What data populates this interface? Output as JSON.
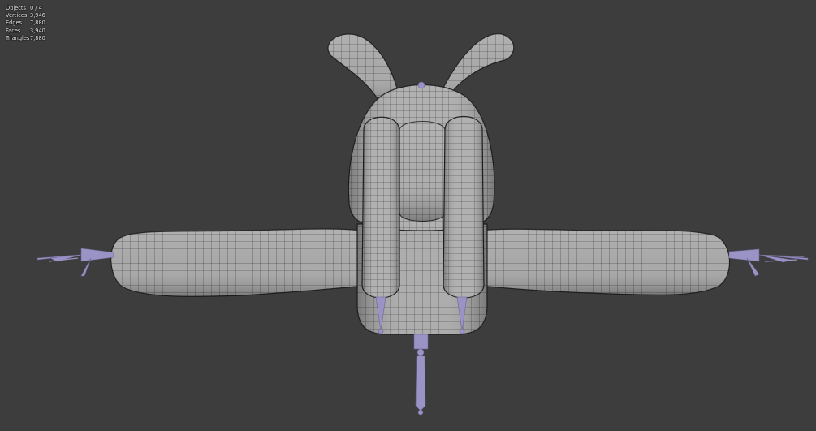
{
  "viewport": {
    "background_color": "#3d3d3d",
    "mesh_fill_color": "#a9a9a9",
    "mesh_wire_color": "#2a2a2a",
    "bone_color": "#9a93c6"
  },
  "stats": [
    {
      "label": "Objects",
      "value": "0 / 4"
    },
    {
      "label": "Vertices",
      "value": "3,946"
    },
    {
      "label": "Edges",
      "value": "7,880"
    },
    {
      "label": "Faces",
      "value": "3,940"
    },
    {
      "label": "Triangles",
      "value": "7,880"
    }
  ]
}
